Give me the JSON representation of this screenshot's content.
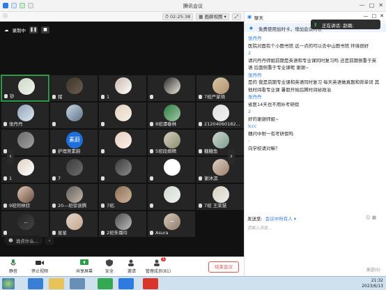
{
  "window": {
    "title": "腾讯会议"
  },
  "toolbar": {
    "timer": "02:25:38",
    "view": "画廊视图"
  },
  "recording": {
    "label": "录制中"
  },
  "tiles": [
    {
      "name": "钞",
      "avatar": "#ccd9c6",
      "av2": "#eef3ec",
      "active": true
    },
    {
      "name": "猪",
      "avatar": "#3f3428",
      "av2": "#6b5e52"
    },
    {
      "name": "1",
      "avatar": "#c9b8a9",
      "av2": "#fff"
    },
    {
      "name": "",
      "avatar": "#2b2b2b",
      "av2": "#f0e8df"
    },
    {
      "name": "7班严家琦",
      "avatar": "#d8c7a6",
      "av2": "#b0906c"
    },
    {
      "name": "张丹丹",
      "avatar": "#8ba3b6",
      "av2": "#dfe6ee"
    },
    {
      "name": "",
      "avatar": "#c8d8e8",
      "av2": "#5e7184"
    },
    {
      "name": "",
      "avatar": "#e2d2bd",
      "av2": "#f6efe6"
    },
    {
      "name": "8班谭春林",
      "avatar": "#2e7b43",
      "av2": "#a2c9a8"
    },
    {
      "name": "21204060182...",
      "avatar": "#dedede",
      "av2": "#f2f2f2"
    },
    {
      "name": "",
      "avatar": "#6a6a6a",
      "av2": "#a0a0a0"
    },
    {
      "name": "护理吴素蔚",
      "avatar": "#1e6fd9",
      "av2": "#1e6fd9",
      "text": "素蔚"
    },
    {
      "name": "",
      "avatar": "#e7cfc1",
      "av2": "#fbeee7"
    },
    {
      "name": "5班段炯晴",
      "avatar": "#d6d0c0",
      "av2": "#8c8c6e"
    },
    {
      "name": "糖糖鱼",
      "avatar": "#cfd6cf",
      "av2": "#7a9e8e"
    },
    {
      "name": "1",
      "avatar": "#ded1c3",
      "av2": "#fff"
    },
    {
      "name": "7",
      "avatar": "#3a3a3a",
      "av2": "#6e6e6e"
    },
    {
      "name": "",
      "avatar": "#3a3a3a",
      "av2": "#8c8c8c"
    },
    {
      "name": "",
      "avatar": "#ffffff",
      "av2": "#ffffff"
    },
    {
      "name": "谢沐淇",
      "avatar": "#ddcfc4",
      "av2": "#9b7f6b"
    },
    {
      "name": "9班何林欣",
      "avatar": "#e0c6b6",
      "av2": "#6b4d41"
    },
    {
      "name": "20---班徐诶腾",
      "avatar": "#5e5e5e",
      "av2": "#c6b7a8"
    },
    {
      "name": "7班.",
      "avatar": "#8b6f57",
      "av2": "#d0b39a"
    },
    {
      "name": "",
      "avatar": "#cfd9cf",
      "av2": "#eef3ee"
    },
    {
      "name": "7班 王荣慧",
      "avatar": "#d6cfc4",
      "av2": "#f0ece6"
    },
    {
      "name": "",
      "avatar": "#242424",
      "av2": "#444",
      "text": ".."
    },
    {
      "name": "星星",
      "avatar": "#e5d5c8",
      "av2": "#c2a68e"
    },
    {
      "name": "2班朱璐玲",
      "avatar": "#4a4a4a",
      "av2": "#bfbfbf"
    },
    {
      "name": "Asura",
      "avatar": "#d8c8b8",
      "av2": "#8e7c6b",
      "text": "~"
    }
  ],
  "speaking_bar": {
    "label": "说点什么..."
  },
  "bottom": {
    "mute": "静音",
    "stop_video": "停止视频",
    "share": "共享屏幕",
    "security": "安全",
    "invite": "邀请",
    "manage": "管理成员(81)",
    "members_badge": "1",
    "end": "结束会议"
  },
  "chat": {
    "header": "聊天",
    "notice": "免费使用加时卡，增加会议时长",
    "toast": "正在讲话: 赵璐;",
    "messages": [
      {
        "name": "张丹丹",
        "text": "医院对面有个小图书馆 远一点的可以去中山图书馆 环境很好"
      },
      {
        "name": "2",
        "text": "请问丹丹师姐前期是英语和专业课同时复习吗 还是前期侧重于英语 后面侧重于专业课呢 谢谢~"
      },
      {
        "name": "张丹丹",
        "text": "是的 我是前期专业课和英语同时复习 每天英语做真题和背单词 其他时间看专业课 暑假开始后腾时间给政治"
      },
      {
        "name": "张丹丹",
        "text": "省医14天也不用补考研假"
      },
      {
        "name": "2",
        "text": "好的谢谢师姐~"
      },
      {
        "name": "lccc",
        "text": "穗问中附一有考研假吗"
      },
      {
        "name": "-",
        "text": "向学校请对嘛？"
      }
    ],
    "send_to_label": "发送至:",
    "send_to_value": "会议中所有人",
    "placeholder": "请输入消息...",
    "send_button": "发送(S)"
  },
  "taskbar": {
    "time": "21:32",
    "date": "2023/6/13"
  }
}
